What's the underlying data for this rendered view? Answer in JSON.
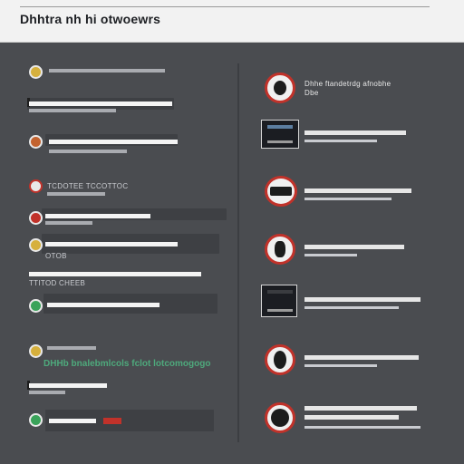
{
  "app": {
    "title": "Dhhtra nh hi otwoewrs"
  },
  "left_list": {
    "items": [
      {
        "dot_color": "#d6b03d",
        "caption": ""
      },
      {
        "dot_color": "#e8e8e8",
        "caption": ""
      },
      {
        "dot_color": "#c3632f",
        "caption": ""
      },
      {
        "dot_color": "#e8e8e8",
        "caption": "TCDOTEE TCCOTTOC"
      },
      {
        "dot_color": "#c1322a",
        "caption": ""
      },
      {
        "dot_color": "#d6b03d",
        "caption": "OTOB"
      },
      {
        "dot_color": "#e8e8e8",
        "caption": "TTITOD CHEEB"
      },
      {
        "dot_color": "#3aa35a",
        "caption": ""
      },
      {
        "dot_color": "#d6b03d",
        "caption": ""
      },
      {
        "dot_color": "#e8e8e8",
        "caption": ""
      },
      {
        "dot_color": "#3aa35a",
        "caption": ""
      }
    ],
    "highlight_text": "DHHb bnalebmlcols fclot lotcomogogo"
  },
  "right_list": {
    "items": [
      {
        "icon": "record-icon",
        "label": "Dhhe ftandetrdg afnobhe",
        "sublabel": "Dbe"
      },
      {
        "icon": "monitor-icon",
        "label": ""
      },
      {
        "icon": "camera-icon",
        "label": ""
      },
      {
        "icon": "bottle-icon",
        "label": ""
      },
      {
        "icon": "monitor-icon",
        "label": ""
      },
      {
        "icon": "record-icon",
        "label": ""
      },
      {
        "icon": "record-icon",
        "label": ""
      }
    ]
  },
  "colors": {
    "accent_red": "#c1322a",
    "accent_green": "#4ea97c",
    "panel_bg": "#4a4c50",
    "header_bg": "#f2f2f2"
  }
}
